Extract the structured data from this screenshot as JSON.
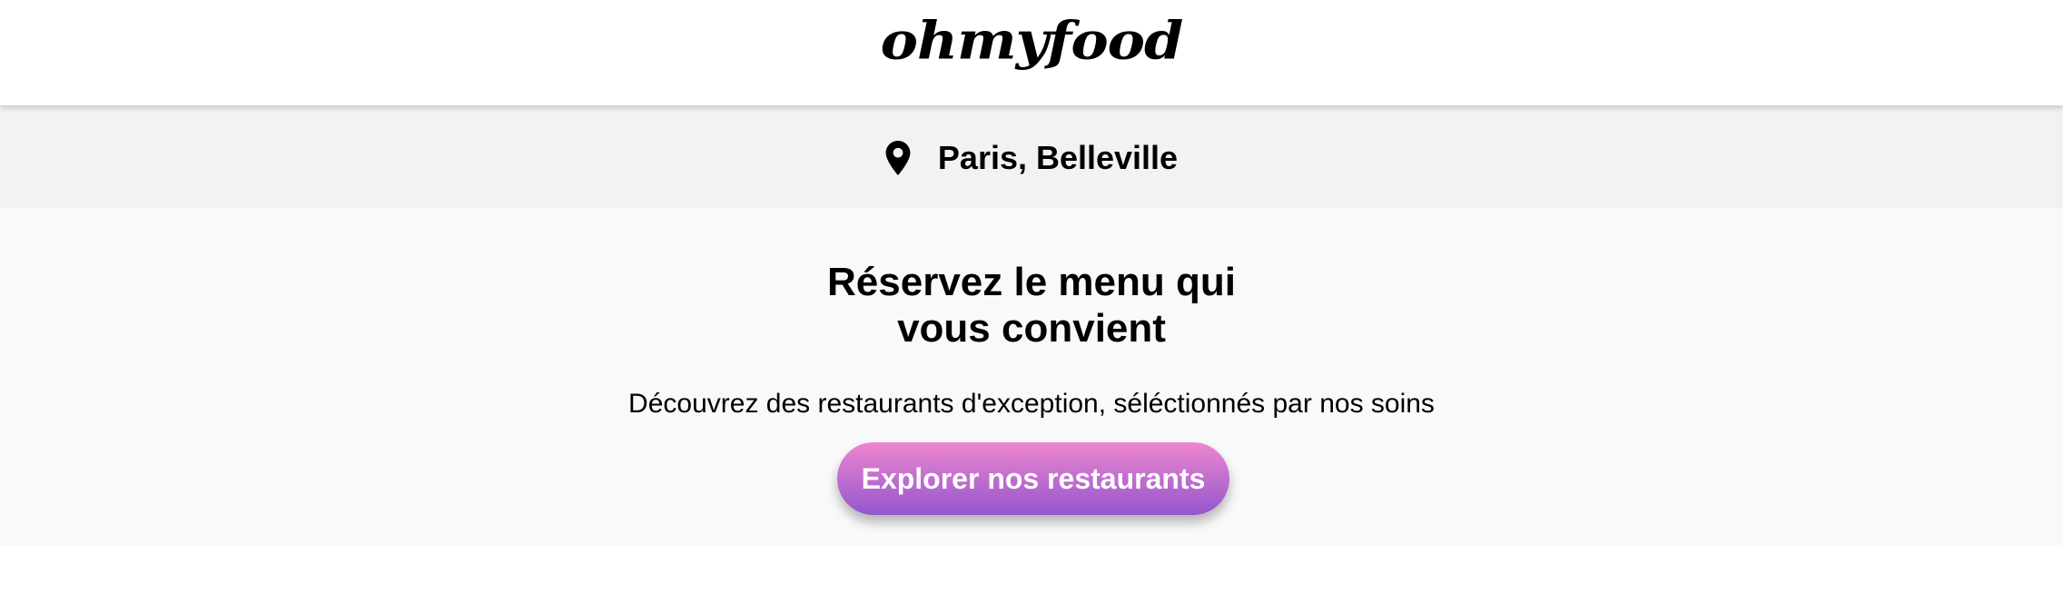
{
  "header": {
    "logo_text": "ohmyfood"
  },
  "location": {
    "icon": "map-pin-icon",
    "label": "Paris, Belleville"
  },
  "hero": {
    "title_line1": "Réservez le menu qui",
    "title_line2": "vous convient",
    "subtitle": "Découvrez des restaurants d'exception, séléctionnés par nos soins",
    "cta_label": "Explorer nos restaurants"
  },
  "colors": {
    "header_bg": "#ffffff",
    "location_bg": "#f2f2f2",
    "hero_bg": "#f9f9f9",
    "cta_gradient_start": "#ee86cf",
    "cta_gradient_end": "#9456ce",
    "text": "#000000"
  }
}
